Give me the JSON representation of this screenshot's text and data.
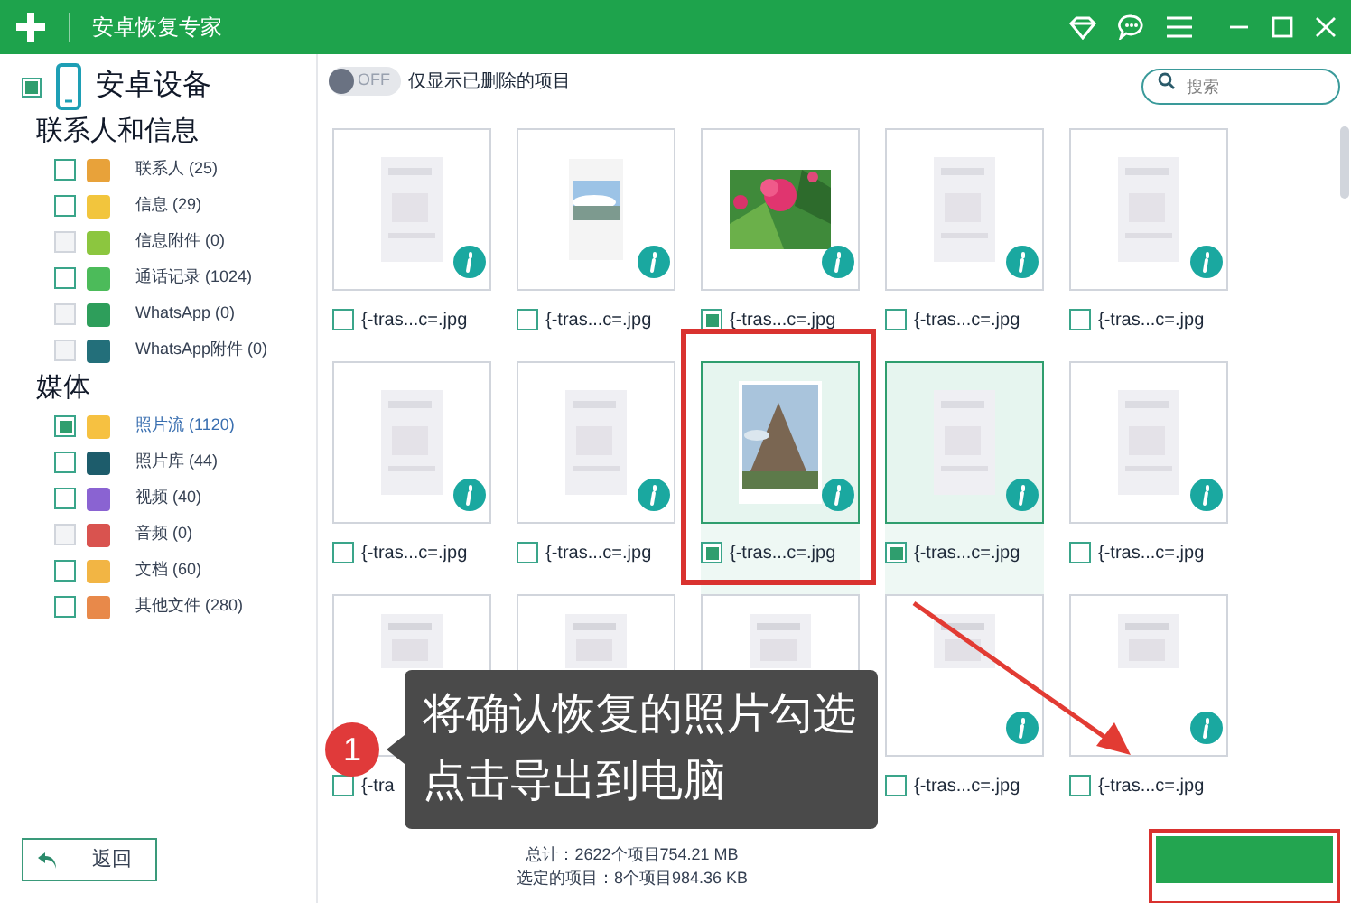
{
  "window": {
    "title": "安卓恢复专家"
  },
  "device": {
    "name": "安卓设备",
    "checked": true
  },
  "filter": {
    "toggle_label": "OFF",
    "on": false,
    "label": "仅显示已删除的项目"
  },
  "search": {
    "placeholder": "搜索"
  },
  "sidebar": [
    {
      "heading": "联系人和信息",
      "items": [
        {
          "label": "联系人 (25)",
          "color": "#e8a23a",
          "checked": false,
          "disabled": false,
          "selected": false
        },
        {
          "label": "信息 (29)",
          "color": "#f2c53d",
          "checked": false,
          "disabled": false,
          "selected": false
        },
        {
          "label": "信息附件 (0)",
          "color": "#8cc63f",
          "checked": false,
          "disabled": true,
          "selected": false
        },
        {
          "label": "通话记录 (1024)",
          "color": "#4cbb5a",
          "checked": false,
          "disabled": false,
          "selected": false
        },
        {
          "label": "WhatsApp (0)",
          "color": "#2e9e5b",
          "checked": false,
          "disabled": true,
          "selected": false
        },
        {
          "label": "WhatsApp附件 (0)",
          "color": "#236f7a",
          "checked": false,
          "disabled": true,
          "selected": false
        }
      ]
    },
    {
      "heading": "媒体",
      "items": [
        {
          "label": "照片流 (1120)",
          "color": "#f6c141",
          "checked": true,
          "disabled": false,
          "selected": true
        },
        {
          "label": "照片库 (44)",
          "color": "#1d5c6b",
          "checked": false,
          "disabled": false,
          "selected": false
        },
        {
          "label": "视频 (40)",
          "color": "#8a63d2",
          "checked": false,
          "disabled": false,
          "selected": false
        },
        {
          "label": "音频 (0)",
          "color": "#d9534f",
          "checked": false,
          "disabled": true,
          "selected": false
        },
        {
          "label": "文档 (60)",
          "color": "#f2b544",
          "checked": false,
          "disabled": false,
          "selected": false
        },
        {
          "label": "其他文件 (280)",
          "color": "#e8894a",
          "checked": false,
          "disabled": false,
          "selected": false
        }
      ]
    }
  ],
  "photos": [
    {
      "name": "{-tras...c=.jpg",
      "checked": false,
      "selected": false
    },
    {
      "name": "{-tras...c=.jpg",
      "checked": false,
      "selected": false
    },
    {
      "name": "{-tras...c=.jpg",
      "checked": true,
      "selected": false
    },
    {
      "name": "{-tras...c=.jpg",
      "checked": false,
      "selected": false
    },
    {
      "name": "{-tras...c=.jpg",
      "checked": false,
      "selected": false
    },
    {
      "name": "{-tras...c=.jpg",
      "checked": false,
      "selected": false
    },
    {
      "name": "{-tras...c=.jpg",
      "checked": false,
      "selected": false
    },
    {
      "name": "{-tras...c=.jpg",
      "checked": true,
      "selected": true
    },
    {
      "name": "{-tras...c=.jpg",
      "checked": true,
      "selected": true
    },
    {
      "name": "{-tras...c=.jpg",
      "checked": false,
      "selected": false
    },
    {
      "name": "{-tra",
      "checked": false,
      "selected": false
    },
    {
      "selected": false
    },
    {
      "selected": false
    },
    {
      "name": "{-tras...c=.jpg",
      "checked": false,
      "selected": false
    },
    {
      "name": "{-tras...c=.jpg",
      "checked": false,
      "selected": false
    }
  ],
  "tip": {
    "step": "1",
    "lines": [
      "将确认恢复的照片勾选",
      "点击导出到电脑"
    ]
  },
  "footer": {
    "total": "总计：2622个项目754.21 MB",
    "selected": "选定的项目：8个项目984.36 KB",
    "back_button": "返回"
  }
}
